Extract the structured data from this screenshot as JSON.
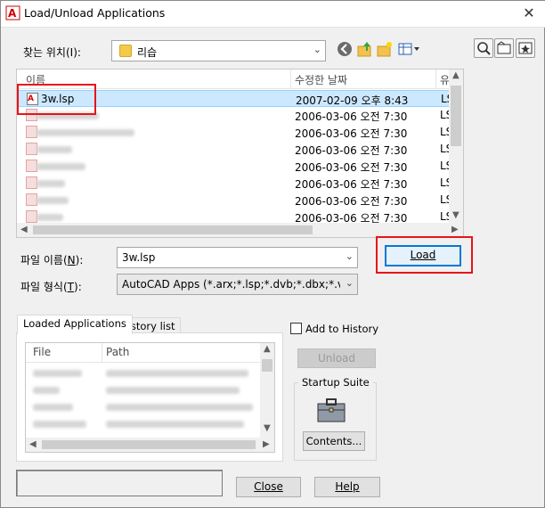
{
  "window": {
    "title": "Load/Unload Applications",
    "close_glyph": "✕"
  },
  "lookin": {
    "label": "찾는 위치(I):",
    "value": "리습"
  },
  "file_list": {
    "columns": [
      "이름",
      "수정한 날짜",
      "유"
    ],
    "rows": [
      {
        "name": "3w.lsp",
        "date": "2007-02-09 오후 8:43",
        "type": "LS",
        "selected": true
      },
      {
        "name": "",
        "date": "2006-03-06 오전 7:30",
        "type": "LS"
      },
      {
        "name": "",
        "date": "2006-03-06 오전 7:30",
        "type": "LS"
      },
      {
        "name": "",
        "date": "2006-03-06 오전 7:30",
        "type": "LS"
      },
      {
        "name": "",
        "date": "2006-03-06 오전 7:30",
        "type": "LS"
      },
      {
        "name": "",
        "date": "2006-03-06 오전 7:30",
        "type": "LS"
      },
      {
        "name": "",
        "date": "2006-03-06 오전 7:30",
        "type": "LS"
      },
      {
        "name": "",
        "date": "2006-03-06 오전 7:30",
        "type": "LS"
      }
    ]
  },
  "filename": {
    "label_pre": "파일 이름(",
    "label_key": "N",
    "label_post": "):",
    "value": "3w.lsp"
  },
  "filetype": {
    "label_pre": "파일 형식(",
    "label_key": "T",
    "label_post": "):",
    "value": "AutoCAD Apps (*.arx;*.lsp;*.dvb;*.dbx;*.vlx;*.fas)"
  },
  "buttons": {
    "load": "Load",
    "unload": "Unload",
    "contents": "Contents...",
    "close": "Close",
    "help": "Help"
  },
  "tabs": {
    "loaded": "Loaded Applications",
    "history": "History list"
  },
  "loaded_list": {
    "columns": [
      "File",
      "Path"
    ]
  },
  "add_to_history": "Add to History",
  "startup_suite": "Startup Suite",
  "colors": {
    "highlight": "#e8131a",
    "selection": "#cce8ff",
    "focus": "#0078d7"
  }
}
